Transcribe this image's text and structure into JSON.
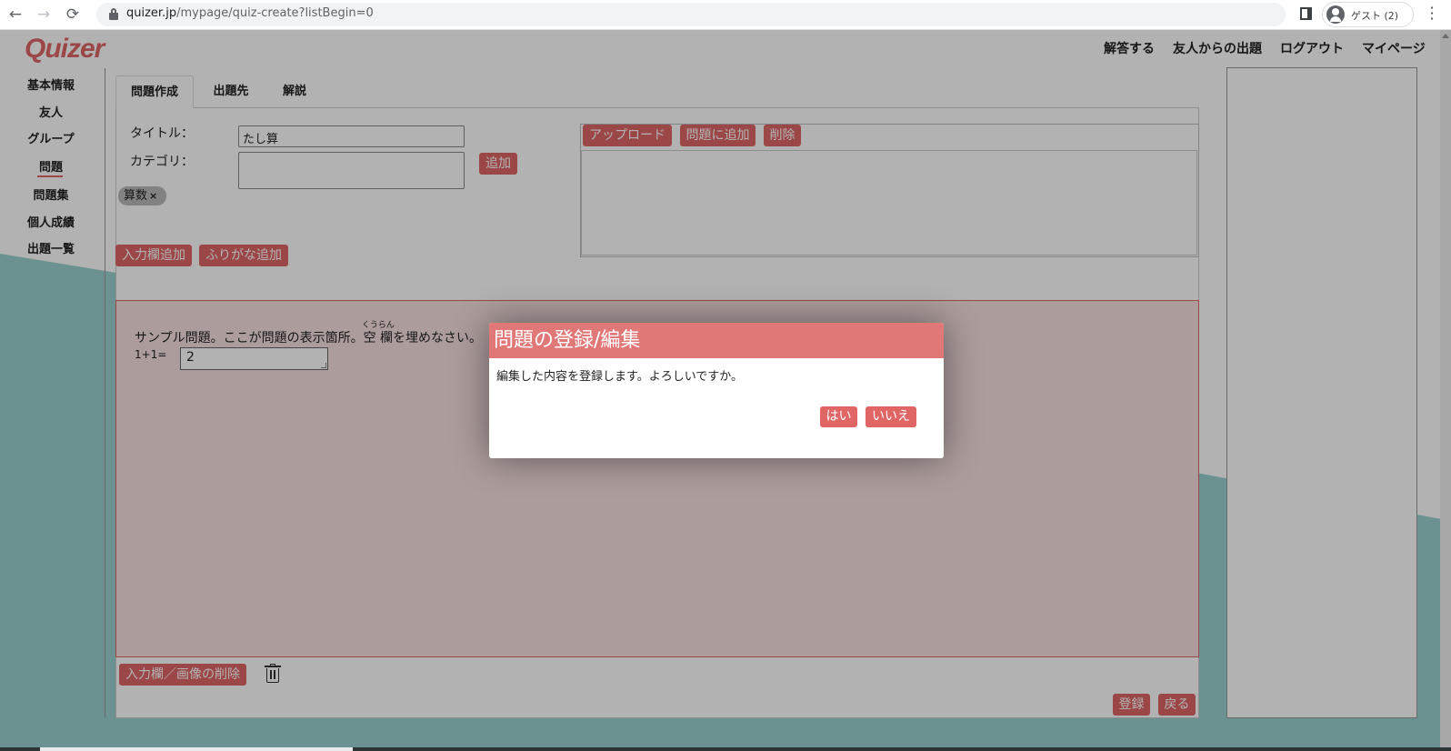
{
  "browser": {
    "url_host": "quizer.jp",
    "url_path": "/mypage/quiz-create?listBegin=0",
    "profile_name": "ゲスト (2)"
  },
  "header": {
    "logo": "Quizer",
    "nav": [
      "解答する",
      "友人からの出題",
      "ログアウト",
      "マイページ"
    ]
  },
  "sidebar": {
    "items": [
      "基本情報",
      "友人",
      "グループ",
      "問題",
      "問題集",
      "個人成績",
      "出題一覧"
    ],
    "active": "問題"
  },
  "tabs": [
    "問題作成",
    "出題先",
    "解説"
  ],
  "form": {
    "title_label": "タイトル：",
    "title_value": "たし算",
    "category_label": "カテゴリ：",
    "category_value": "",
    "add_button": "追加",
    "chips": [
      "算数"
    ],
    "add_input_button": "入力欄追加",
    "add_furigana_button": "ふりがな追加"
  },
  "image_panel": {
    "upload_button": "アップロード",
    "add_to_quiz_button": "問題に追加",
    "delete_button": "削除"
  },
  "quiz": {
    "text_before": "サンプル問題。ここが問題の表示箇所。",
    "ruby_base": "空",
    "ruby_text": "くうらん",
    "text_after": "欄を埋めなさい。",
    "equation": "1+1=",
    "answer_value": "2"
  },
  "bottom": {
    "delete_input_button": "入力欄／画像の削除",
    "register_button": "登録",
    "back_button": "戻る"
  },
  "dialog": {
    "title": "問題の登録/編集",
    "message": "編集した内容を登録します。よろしいですか。",
    "yes_button": "はい",
    "no_button": "いいえ"
  },
  "colors": {
    "accent": "#e06666",
    "dialog_header": "#e07878",
    "teal": "#9ad1cf"
  }
}
